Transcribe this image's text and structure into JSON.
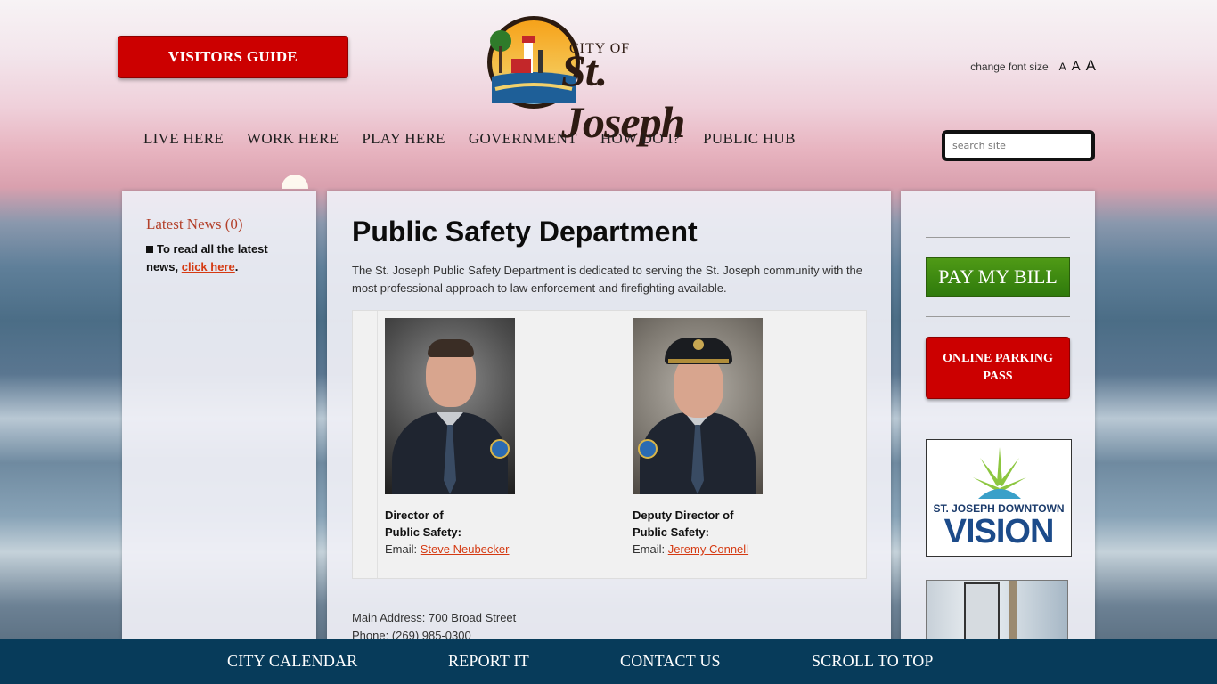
{
  "header": {
    "visitors_guide_label": "VISITORS GUIDE",
    "logo_city_of": "CITY OF",
    "logo_name": "St. Joseph",
    "font_size_label": "change font size",
    "font_sizes": [
      "A",
      "A",
      "A"
    ],
    "search_placeholder": "search site"
  },
  "nav": {
    "items": [
      "LIVE HERE",
      "WORK HERE",
      "PLAY HERE",
      "GOVERNMENT",
      "HOW DO I?",
      "PUBLIC HUB"
    ]
  },
  "left_panel": {
    "news_title": "Latest News (0)",
    "news_text": "To read all the latest news,",
    "news_link": "click here",
    "news_end": "."
  },
  "main": {
    "title": "Public Safety Department",
    "intro": "The St. Joseph Public Safety Department is dedicated to serving the St. Joseph community with the most professional approach to law enforcement and firefighting available.",
    "staff": [
      {
        "role_line1": "Director of",
        "role_line2": "Public Safety:",
        "email_label": "Email:",
        "email_name": "Steve Neubecker"
      },
      {
        "role_line1": "Deputy Director of",
        "role_line2": "Public Safety:",
        "email_label": "Email:",
        "email_name": "Jeremy Connell"
      }
    ],
    "address": "Main Address: 700 Broad Street",
    "phone": "Phone: (269) 985-0300"
  },
  "right_panel": {
    "pay_bill": "PAY MY BILL",
    "parking_line1": "ONLINE PARKING",
    "parking_line2": "PASS",
    "vision_line1": "ST. JOSEPH DOWNTOWN",
    "vision_line2": "VISION"
  },
  "footer": {
    "items": [
      "CITY CALENDAR",
      "REPORT IT",
      "CONTACT US",
      "SCROLL TO TOP"
    ]
  },
  "colors": {
    "red_button": "#cc0000",
    "green_button": "#3f8a10",
    "footer_bg": "#073b5a",
    "link": "#d53a12"
  }
}
